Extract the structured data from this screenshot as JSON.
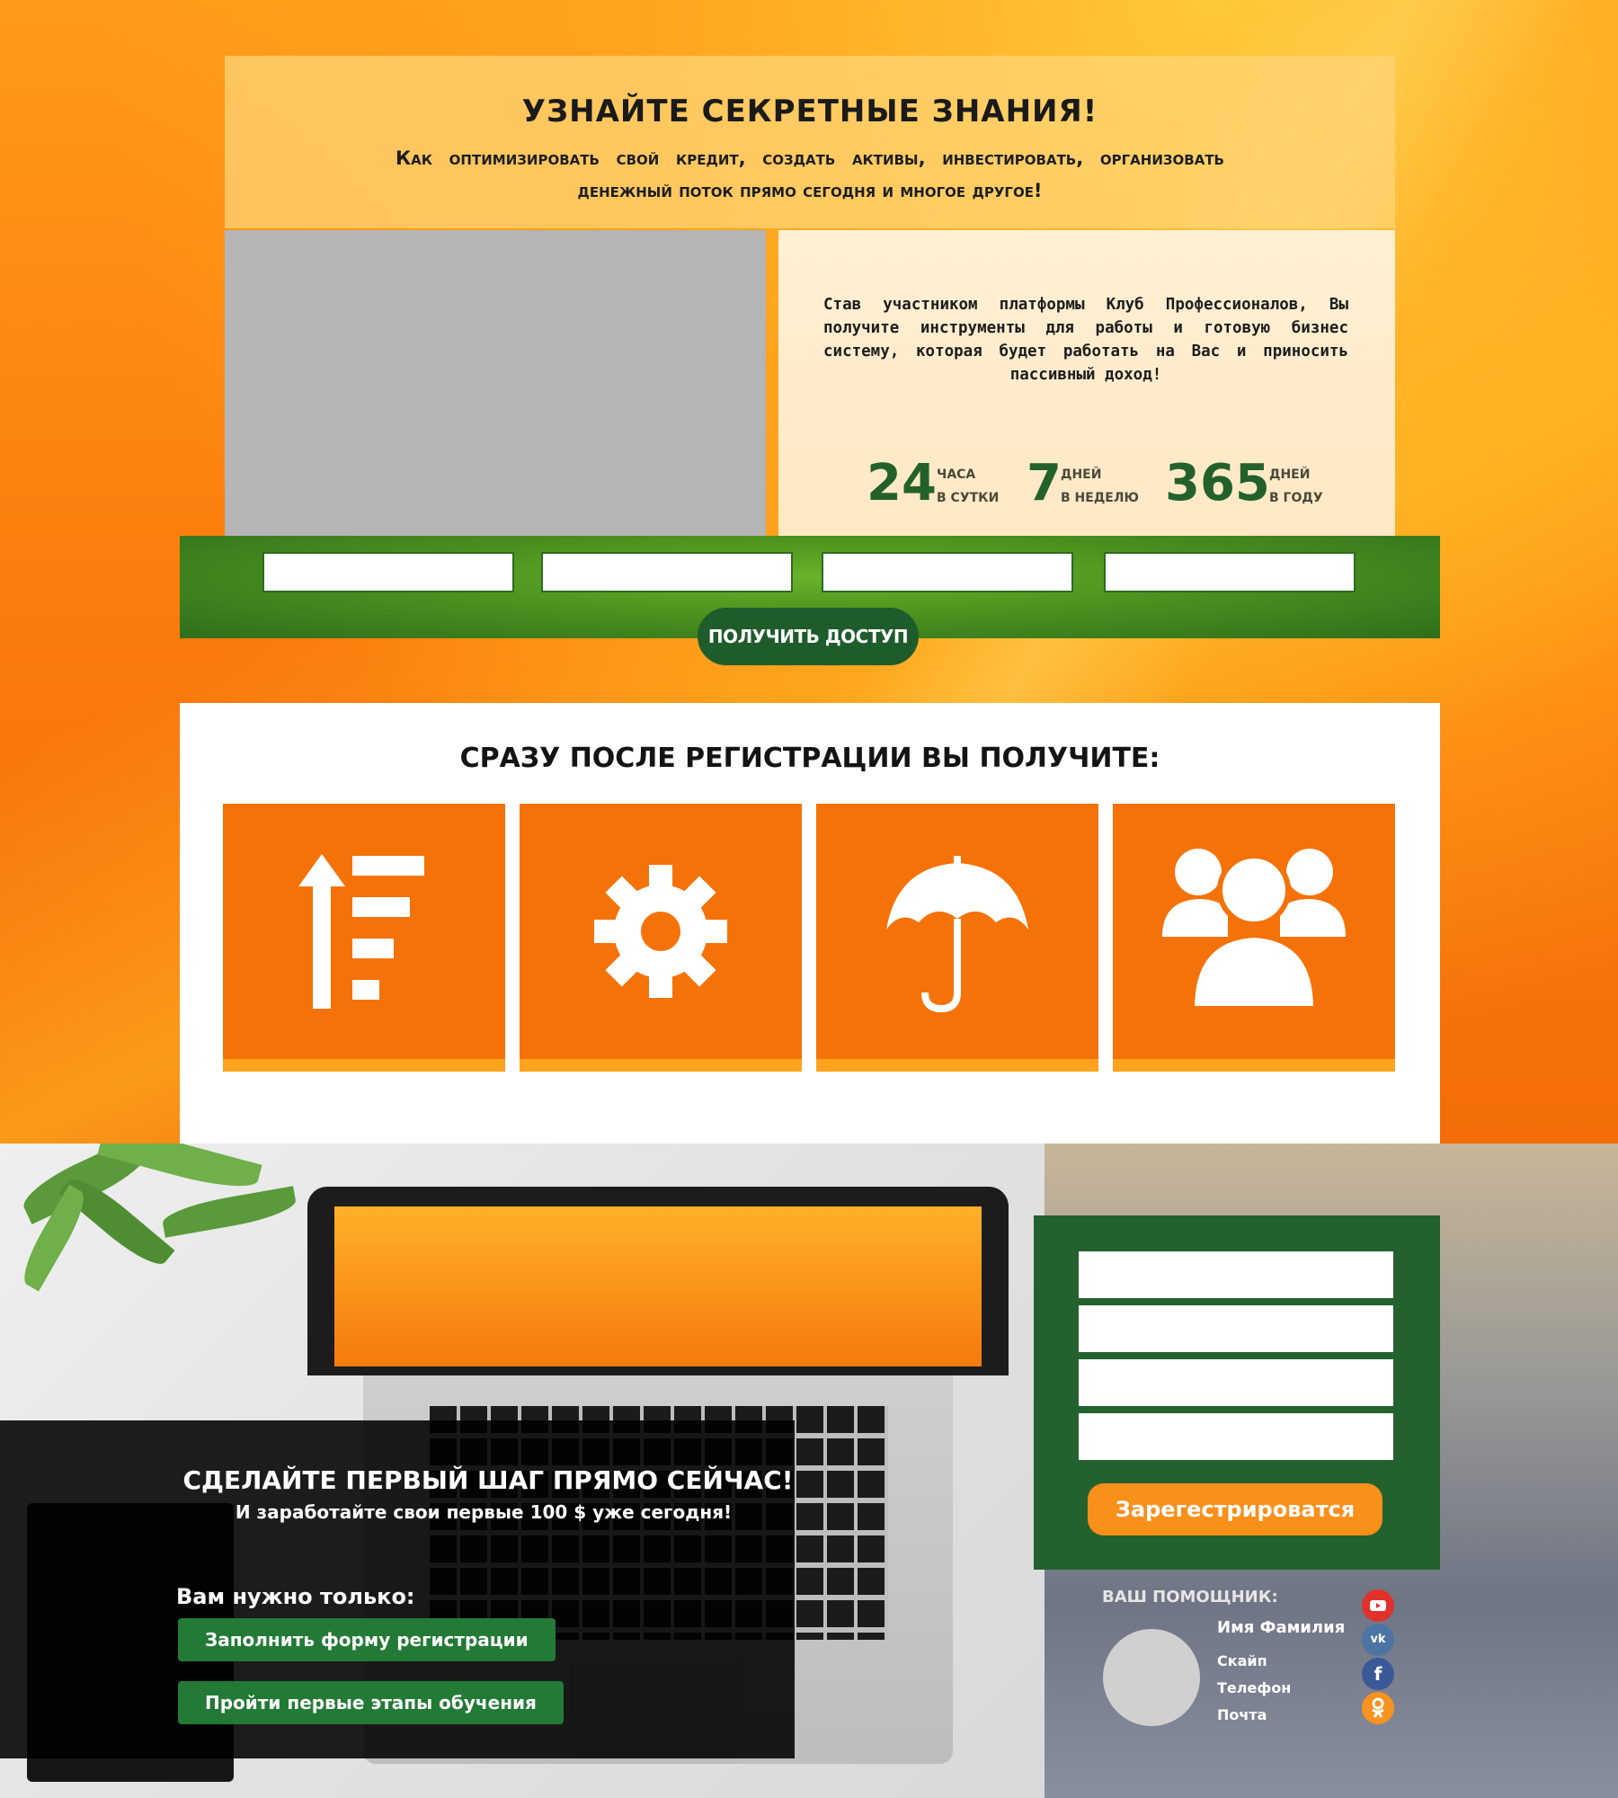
{
  "hero": {
    "title": "УЗНАЙТЕ СЕКРЕТНЫЕ ЗНАНИЯ!",
    "subtitle": "Как оптимизировать свой кредит, создать активы, инвестировать, организовать денежный поток прямо сегодня и многое другое!"
  },
  "info": {
    "text": "Став участником платформы Клуб Профессионалов, Вы получите инструменты для работы и готовую бизнес систему, которая будет работать на Вас и приносить пассивный доход!",
    "stats": [
      {
        "number": "24",
        "line1": "ЧАСА",
        "line2": "В СУТКИ"
      },
      {
        "number": "7",
        "line1": "ДНЕЙ",
        "line2": "В НЕДЕЛЮ"
      },
      {
        "number": "365",
        "line1": "ДНЕЙ",
        "line2": "В ГОДУ"
      }
    ]
  },
  "access_form": {
    "button_label": "ПОЛУЧИТЬ ДОСТУП"
  },
  "benefits": {
    "title": "СРАЗУ ПОСЛЕ РЕГИСТРАЦИИ ВЫ ПОЛУЧИТЕ:",
    "icons": [
      "growth-list-icon",
      "gear-icon",
      "umbrella-icon",
      "group-icon"
    ]
  },
  "cta": {
    "title": "СДЕЛАЙТЕ ПЕРВЫЙ ШАГ ПРЯМО СЕЙЧАС!",
    "subtitle": "И заработайте свои первые 100 $ уже сегодня!",
    "need_label": "Вам нужно только:",
    "steps": [
      "Заполнить форму регистрации",
      "Пройти первые этапы обучения"
    ]
  },
  "registration": {
    "button_label": "Зарегестрироватся"
  },
  "helper": {
    "title": "ВАШ ПОМОЩНИК:",
    "name": "Имя Фамилия",
    "skype": "Скайп",
    "phone": "Телефон",
    "email": "Почта"
  },
  "social": [
    {
      "name": "youtube-icon",
      "color": "#e0312b"
    },
    {
      "name": "vk-icon",
      "color": "#4c75a3"
    },
    {
      "name": "facebook-icon",
      "color": "#3b5998"
    },
    {
      "name": "odnoklassniki-icon",
      "color": "#f7931e"
    }
  ],
  "colors": {
    "orange": "#f57208",
    "green": "#23612f",
    "stat_green": "#23612a",
    "button_orange": "#f8901a"
  }
}
